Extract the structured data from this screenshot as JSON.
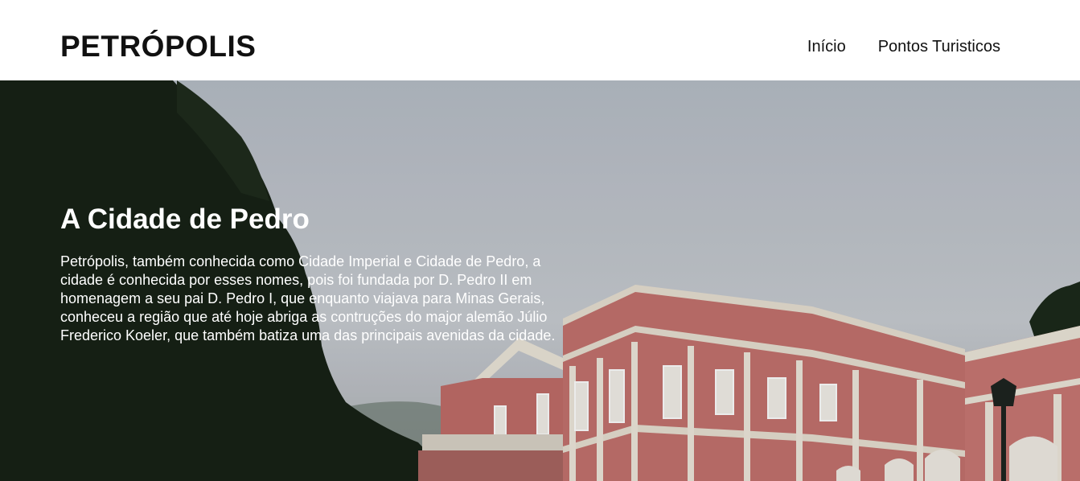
{
  "header": {
    "brand": "PETRÓPOLIS",
    "nav": [
      {
        "label": "Início"
      },
      {
        "label": "Pontos Turisticos"
      }
    ]
  },
  "hero": {
    "title": "A Cidade de Pedro",
    "text": "Petrópolis, também conhecida como Cidade Imperial e Cidade de Pedro, a cidade é conhecida por esses nomes, pois foi fundada por D. Pedro II em homenagem a seu pai D. Pedro I, que enquanto viajava para Minas Gerais, conheceu a região que até hoje abriga as contruções do major alemão Júlio Frederico Koeler, que também batiza uma das principais avenidas da cidade."
  },
  "colors": {
    "sky": "#c1c6cd",
    "trees": "#1a2418",
    "facade": "#c9746f",
    "trim": "#ece6da"
  }
}
